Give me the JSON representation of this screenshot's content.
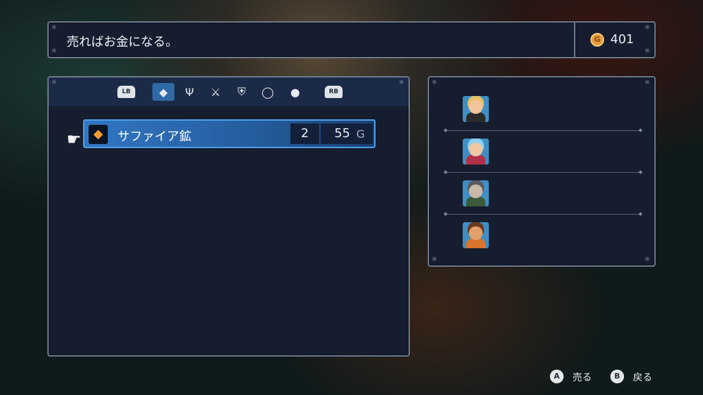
{
  "message": {
    "text": "売ればお金になる。"
  },
  "gold": {
    "icon": "G",
    "value": "401"
  },
  "tabs": {
    "left_bumper": "LB",
    "right_bumper": "RB",
    "items": [
      {
        "name": "gem-icon",
        "glyph": "◆",
        "active": true
      },
      {
        "name": "fork-icon",
        "glyph": "Ψ",
        "active": false
      },
      {
        "name": "sword-icon",
        "glyph": "⚔",
        "active": false
      },
      {
        "name": "shield-icon",
        "glyph": "⛨",
        "active": false
      },
      {
        "name": "ring-icon",
        "glyph": "◯",
        "active": false
      },
      {
        "name": "apple-icon",
        "glyph": "●",
        "active": false
      }
    ]
  },
  "cursor_glyph": "☛",
  "item": {
    "icon": "◆",
    "name": "サファイア鉱",
    "qty": "2",
    "price": "55",
    "price_unit": "G"
  },
  "party": [
    {
      "name": "blonde-hero",
      "hair": "#e7c26a",
      "skin": "#f2c49a",
      "body": "#2a2a2a"
    },
    {
      "name": "blue-hair-girl",
      "hair": "#8fd0f0",
      "skin": "#f1c6a2",
      "body": "#b0304a"
    },
    {
      "name": "masked-ninja",
      "hair": "#5a5a62",
      "skin": "#c9b9a6",
      "body": "#3a5a3a"
    },
    {
      "name": "brown-hair-boy",
      "hair": "#6a3a1e",
      "skin": "#e2a06a",
      "body": "#d8742c"
    }
  ],
  "hints": {
    "sell_key": "A",
    "sell_label": "売る",
    "back_key": "B",
    "back_label": "戻る"
  }
}
